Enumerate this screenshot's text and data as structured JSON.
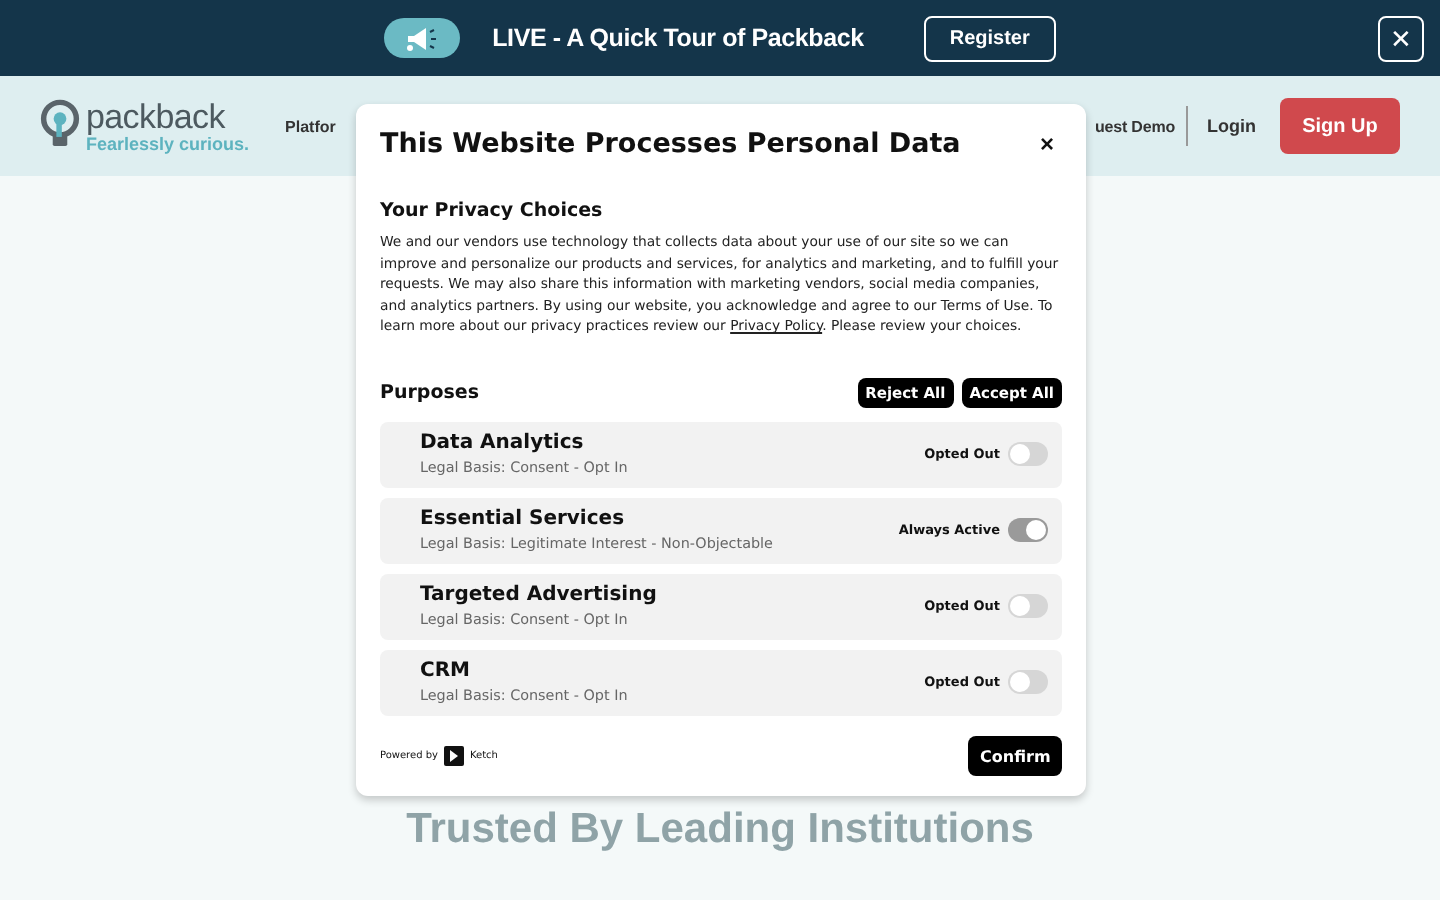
{
  "banner": {
    "title": "LIVE - A Quick Tour of Packback",
    "register": "Register",
    "close": "✕"
  },
  "nav": {
    "logo": "packback",
    "tagline": "Fearlessly curious.",
    "left_item": "Platfor",
    "right_item": "uest Demo",
    "login": "Login",
    "signup": "Sign Up"
  },
  "hero": {
    "heading": "Trusted By Leading Institutions"
  },
  "modal": {
    "title": "This Website Processes Personal Data",
    "close": "×",
    "section_title": "Your Privacy Choices",
    "body": "We and our vendors use technology that collects data about your use of our site so we can improve and personalize our products and services, for analytics and marketing, and to fulfill your requests. We may also share this information with marketing vendors, social media companies, and analytics partners. By using our website, you acknowledge and agree to our Terms of Use. To learn more about our privacy practices review our ",
    "link": "Privacy Policy",
    "body_end": ". Please review your choices.",
    "purposes_title": "Purposes",
    "reject": "Reject All",
    "accept": "Accept All",
    "purposes": [
      {
        "name": "Data Analytics",
        "basis": "Legal Basis: Consent - Opt In",
        "status": "Opted Out",
        "on": false,
        "disabled": false
      },
      {
        "name": "Essential Services",
        "basis": "Legal Basis: Legitimate Interest - Non-Objectable",
        "status": "Always Active",
        "on": true,
        "disabled": true
      },
      {
        "name": "Targeted Advertising",
        "basis": "Legal Basis: Consent - Opt In",
        "status": "Opted Out",
        "on": false,
        "disabled": false
      },
      {
        "name": "CRM",
        "basis": "Legal Basis: Consent - Opt In",
        "status": "Opted Out",
        "on": false,
        "disabled": false
      }
    ],
    "powered_by": "Powered by",
    "brand": "Ketch",
    "confirm": "Confirm"
  }
}
